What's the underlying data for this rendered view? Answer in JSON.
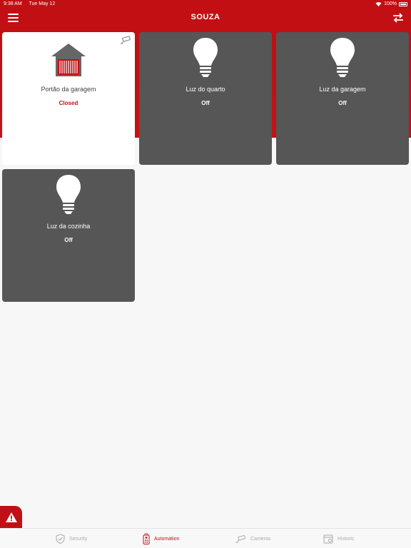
{
  "status_bar": {
    "time": "9:38 AM",
    "date": "Tue May 12",
    "battery": "100%"
  },
  "nav": {
    "title": "SOUZA"
  },
  "cards": [
    {
      "label": "Portão da garagem",
      "state": "Closed"
    },
    {
      "label": "Luz do quarto",
      "state": "Off"
    },
    {
      "label": "Luz da garagem",
      "state": "Off"
    },
    {
      "label": "Luz da cozinha",
      "state": "Off"
    }
  ],
  "tabs": [
    {
      "label": "Security",
      "icon": "shield-check-icon"
    },
    {
      "label": "Automation",
      "icon": "remote-control-icon"
    },
    {
      "label": "Cameras",
      "icon": "camera-icon"
    },
    {
      "label": "Historic",
      "icon": "calendar-icon"
    }
  ],
  "colors": {
    "brand": "#c20f14",
    "card_dark": "#565656",
    "background": "#f7f7f7",
    "tab_inactive": "#a9a9a9"
  }
}
